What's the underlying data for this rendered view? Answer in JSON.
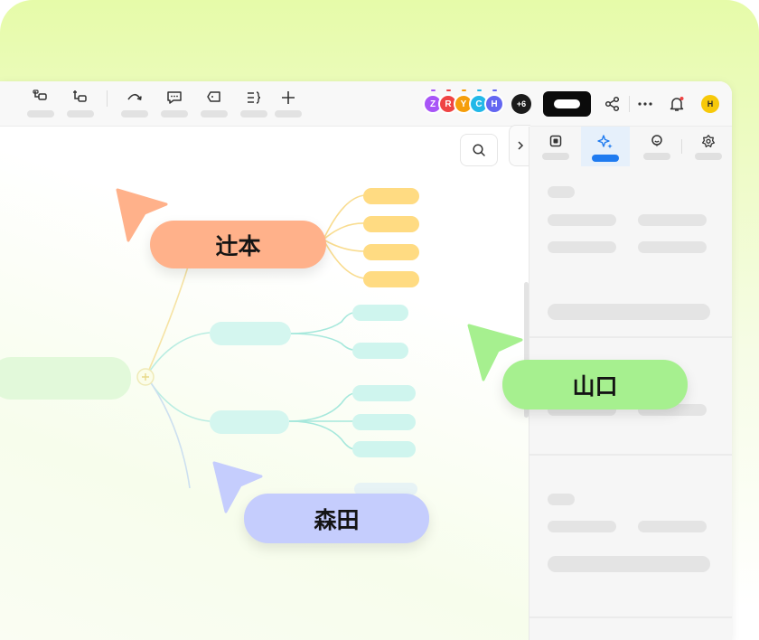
{
  "toolbar": {
    "tools": [
      {
        "name": "add-child-topic-tool",
        "icon": "child-topic-icon"
      },
      {
        "name": "add-sibling-topic-tool",
        "icon": "sibling-topic-icon"
      },
      {
        "name": "relationship-tool",
        "icon": "relationship-arrow-icon"
      },
      {
        "name": "comment-tool",
        "icon": "comment-icon"
      },
      {
        "name": "label-tool",
        "icon": "tag-icon"
      },
      {
        "name": "summary-tool",
        "icon": "summary-brace-icon"
      },
      {
        "name": "insert-tool",
        "icon": "plus-icon"
      }
    ],
    "avatars": [
      {
        "initial": "Z",
        "color": "#a855f7"
      },
      {
        "initial": "R",
        "color": "#ef4444"
      },
      {
        "initial": "Y",
        "color": "#f59e0b"
      },
      {
        "initial": "C",
        "color": "#22b8e8"
      },
      {
        "initial": "H",
        "color": "#6366f1"
      }
    ],
    "extra_count": "+6",
    "user_initial": "H",
    "user_color": "#f7c90a"
  },
  "panel": {
    "tabs": [
      "format-icon",
      "ai-sparkle-icon",
      "marker-icon",
      "sticker-icon"
    ],
    "active_tab": 1,
    "active_color": "#1f7bf0"
  },
  "cursors": [
    {
      "name": "辻本",
      "color": "#ffb18a"
    },
    {
      "name": "山口",
      "color": "#a6f08f"
    },
    {
      "name": "森田",
      "color": "#c5cdfd"
    }
  ],
  "colors": {
    "background_top": "#e6fba9",
    "branch_yellow": "#ffd97a",
    "branch_cyan": "#cff5ee"
  }
}
